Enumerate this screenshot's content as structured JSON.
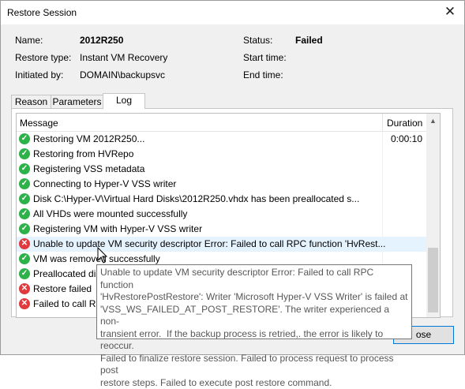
{
  "window": {
    "title": "Restore Session",
    "close_glyph": "✕"
  },
  "info": {
    "name_label": "Name:",
    "name_value": "2012R250",
    "restore_type_label": "Restore type:",
    "restore_type_value": "Instant VM Recovery",
    "initiated_label": "Initiated by:",
    "initiated_value": "DOMAIN\\backupsvc",
    "status_label": "Status:",
    "status_value": "Failed",
    "start_label": "Start time:",
    "start_value": "",
    "end_label": "End time:",
    "end_value": ""
  },
  "tabs": [
    "Reason",
    "Parameters",
    "Log"
  ],
  "log": {
    "header_message": "Message",
    "header_duration": "Duration",
    "rows": [
      {
        "status": "ok",
        "message": "Restoring VM 2012R250...",
        "duration": "0:00:10"
      },
      {
        "status": "ok",
        "message": "Restoring from HVRepo",
        "duration": ""
      },
      {
        "status": "ok",
        "message": "Registering VSS metadata",
        "duration": ""
      },
      {
        "status": "ok",
        "message": "Connecting to Hyper-V VSS writer",
        "duration": ""
      },
      {
        "status": "ok",
        "message": "Disk C:\\Hyper-V\\Virtual Hard Disks\\2012R250.vhdx has been preallocated s...",
        "duration": ""
      },
      {
        "status": "ok",
        "message": "All VHDs were mounted successfully",
        "duration": ""
      },
      {
        "status": "ok",
        "message": "Registering VM with Hyper-V VSS writer",
        "duration": ""
      },
      {
        "status": "error",
        "message": "Unable to update VM security descriptor Error: Failed to call RPC function 'HvRest...",
        "duration": ""
      },
      {
        "status": "ok",
        "message": "VM was removed successfully",
        "duration": ""
      },
      {
        "status": "ok",
        "message": "Preallocated disk",
        "duration": ""
      },
      {
        "status": "error",
        "message": "Restore failed",
        "duration": ""
      },
      {
        "status": "error",
        "message": "Failed to call RPC",
        "duration": ""
      }
    ]
  },
  "tooltip": "Unable to update VM security descriptor Error: Failed to call RPC function\n'HvRestorePostRestore': Writer 'Microsoft Hyper-V VSS Writer' is failed at\n'VSS_WS_FAILED_AT_POST_RESTORE'. The writer experienced a non-\ntransient error.  If the backup process is retried,. the error is likely to reoccur.\nFailed to finalize restore session. Failed to process request to process post\nrestore steps. Failed to execute post restore command.",
  "buttons": {
    "close_visible": "ose"
  },
  "icons": {
    "ok": "check-circle-icon",
    "error": "error-circle-icon"
  },
  "colors": {
    "ok": "#2db24a",
    "error": "#e0393e",
    "selection": "#e5f3ff"
  }
}
